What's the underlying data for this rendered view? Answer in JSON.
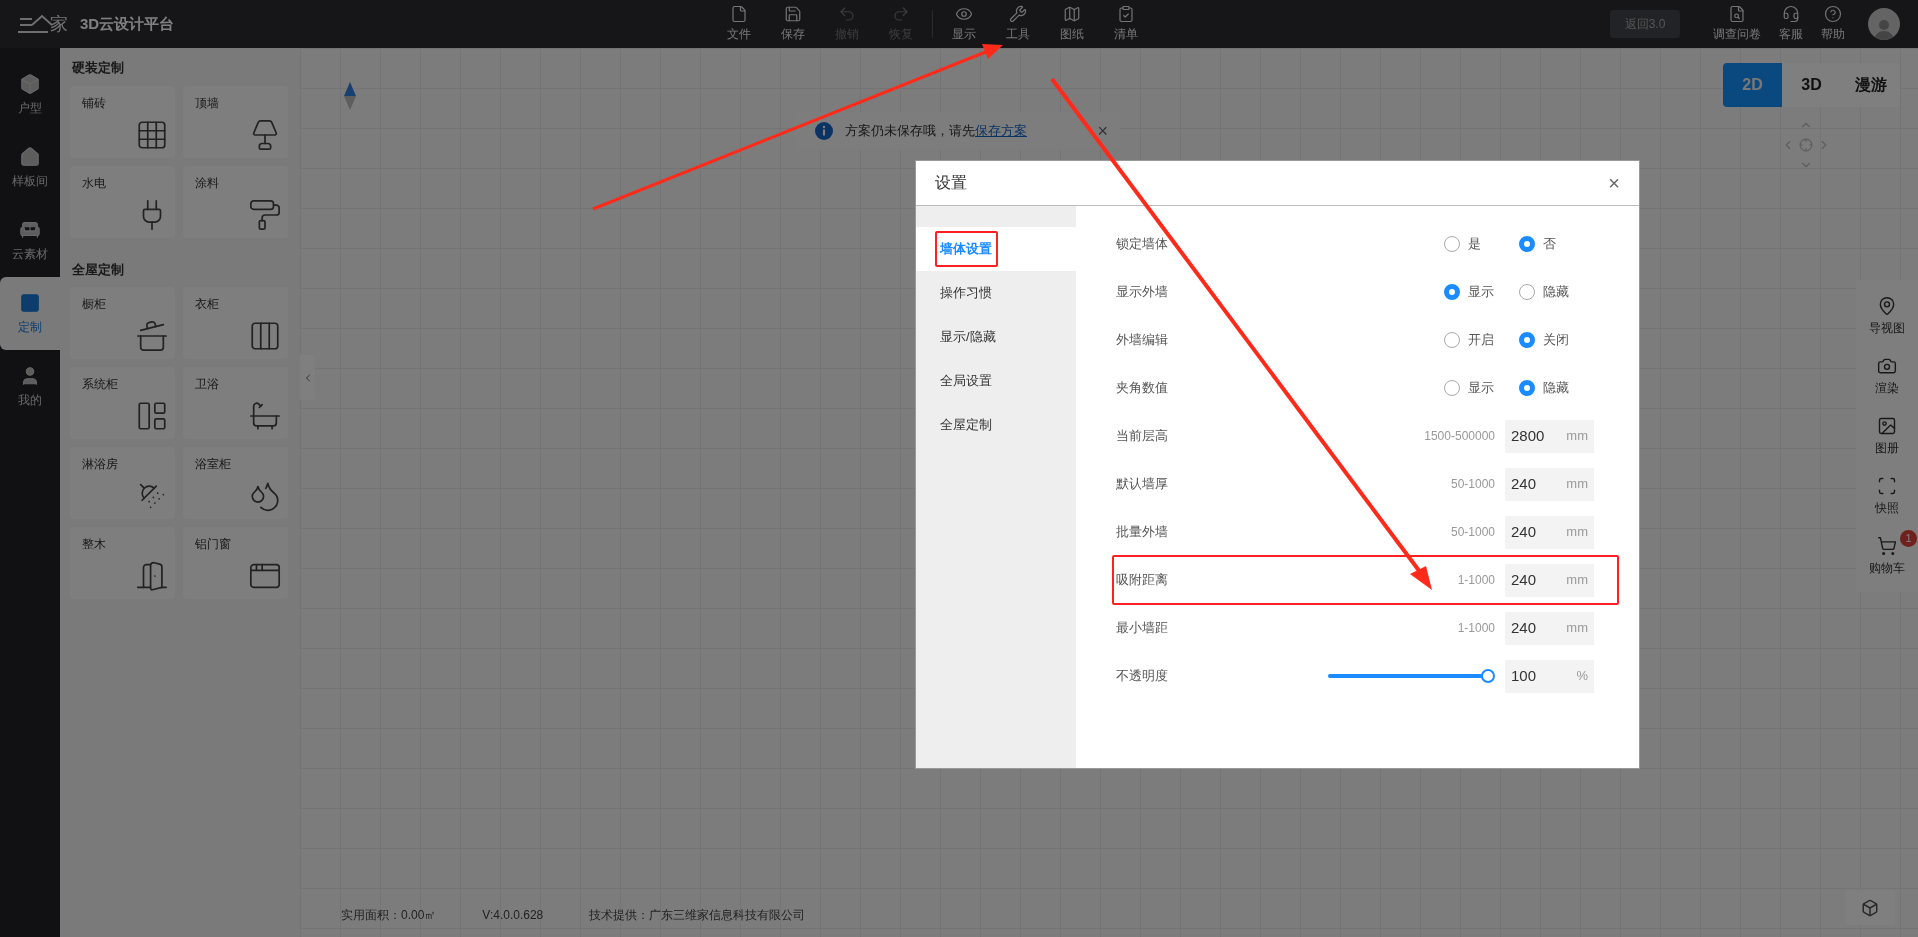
{
  "topbar": {
    "logo_text": "家",
    "title": "3D云设计平台",
    "tools": [
      {
        "label": "文件",
        "disabled": false
      },
      {
        "label": "保存",
        "disabled": false
      },
      {
        "label": "撤销",
        "disabled": true
      },
      {
        "label": "恢复",
        "disabled": true
      },
      {
        "label": "显示",
        "disabled": false
      },
      {
        "label": "工具",
        "disabled": false
      },
      {
        "label": "图纸",
        "disabled": false
      },
      {
        "label": "清单",
        "disabled": false
      }
    ],
    "back_button": "返回3.0",
    "actions": [
      "调查问卷",
      "客服",
      "帮助"
    ]
  },
  "sidebar": {
    "items": [
      {
        "label": "户型",
        "selected": false
      },
      {
        "label": "样板间",
        "selected": false
      },
      {
        "label": "云素材",
        "selected": false
      },
      {
        "label": "定制",
        "selected": true
      },
      {
        "label": "我的",
        "selected": false
      }
    ]
  },
  "panel": {
    "sections": [
      {
        "title": "硬装定制",
        "items": [
          "铺砖",
          "顶墙",
          "水电",
          "涂料"
        ]
      },
      {
        "title": "全屋定制",
        "items": [
          "橱柜",
          "衣柜",
          "系统柜",
          "卫浴",
          "淋浴房",
          "浴室柜",
          "整木",
          "铝门窗"
        ]
      }
    ]
  },
  "notice": {
    "text": "方案仍未保存哦，请先",
    "link": "保存方案",
    "close": "×"
  },
  "view_modes": [
    {
      "label": "2D",
      "selected": true
    },
    {
      "label": "3D",
      "selected": false
    },
    {
      "label": "漫游",
      "selected": false
    }
  ],
  "right_tools": [
    {
      "label": "导视图"
    },
    {
      "label": "渲染"
    },
    {
      "label": "图册"
    },
    {
      "label": "快照"
    },
    {
      "label": "购物车",
      "badge": "1"
    }
  ],
  "footer": [
    "实用面积：0.00㎡",
    "V:4.0.0.628",
    "技术提供：广东三维家信息科技有限公司"
  ],
  "dialog": {
    "title": "设置",
    "close": "×",
    "nav": [
      {
        "label": "墙体设置",
        "selected": true,
        "highlighted": true
      },
      {
        "label": "操作习惯",
        "selected": false,
        "highlighted": false
      },
      {
        "label": "显示/隐藏",
        "selected": false,
        "highlighted": false
      },
      {
        "label": "全局设置",
        "selected": false,
        "highlighted": false
      },
      {
        "label": "全屋定制",
        "selected": false,
        "highlighted": false
      }
    ],
    "rows": [
      {
        "kind": "radio",
        "label": "锁定墙体",
        "highlighted": false,
        "options": [
          {
            "label": "是",
            "selected": false
          },
          {
            "label": "否",
            "selected": true
          }
        ]
      },
      {
        "kind": "radio",
        "label": "显示外墙",
        "highlighted": false,
        "options": [
          {
            "label": "显示",
            "selected": true
          },
          {
            "label": "隐藏",
            "selected": false
          }
        ]
      },
      {
        "kind": "radio",
        "label": "外墙编辑",
        "highlighted": false,
        "options": [
          {
            "label": "开启",
            "selected": false
          },
          {
            "label": "关闭",
            "selected": true
          }
        ]
      },
      {
        "kind": "radio",
        "label": "夹角数值",
        "highlighted": false,
        "options": [
          {
            "label": "显示",
            "selected": false
          },
          {
            "label": "隐藏",
            "selected": true
          }
        ]
      },
      {
        "kind": "number",
        "label": "当前层高",
        "highlighted": false,
        "range": "1500-500000",
        "value": "2800",
        "unit": "mm"
      },
      {
        "kind": "number",
        "label": "默认墙厚",
        "highlighted": false,
        "range": "50-1000",
        "value": "240",
        "unit": "mm"
      },
      {
        "kind": "number",
        "label": "批量外墙",
        "highlighted": false,
        "range": "50-1000",
        "value": "240",
        "unit": "mm"
      },
      {
        "kind": "number",
        "label": "吸附距离",
        "highlighted": true,
        "range": "1-1000",
        "value": "240",
        "unit": "mm"
      },
      {
        "kind": "number",
        "label": "最小墙距",
        "highlighted": false,
        "range": "1-1000",
        "value": "240",
        "unit": "mm"
      },
      {
        "kind": "slider",
        "label": "不透明度",
        "highlighted": false,
        "level": 1,
        "value": "100",
        "unit": "%"
      }
    ]
  },
  "annotations": [
    {
      "kind": "arrow"
    },
    {
      "kind": "arrow"
    }
  ]
}
